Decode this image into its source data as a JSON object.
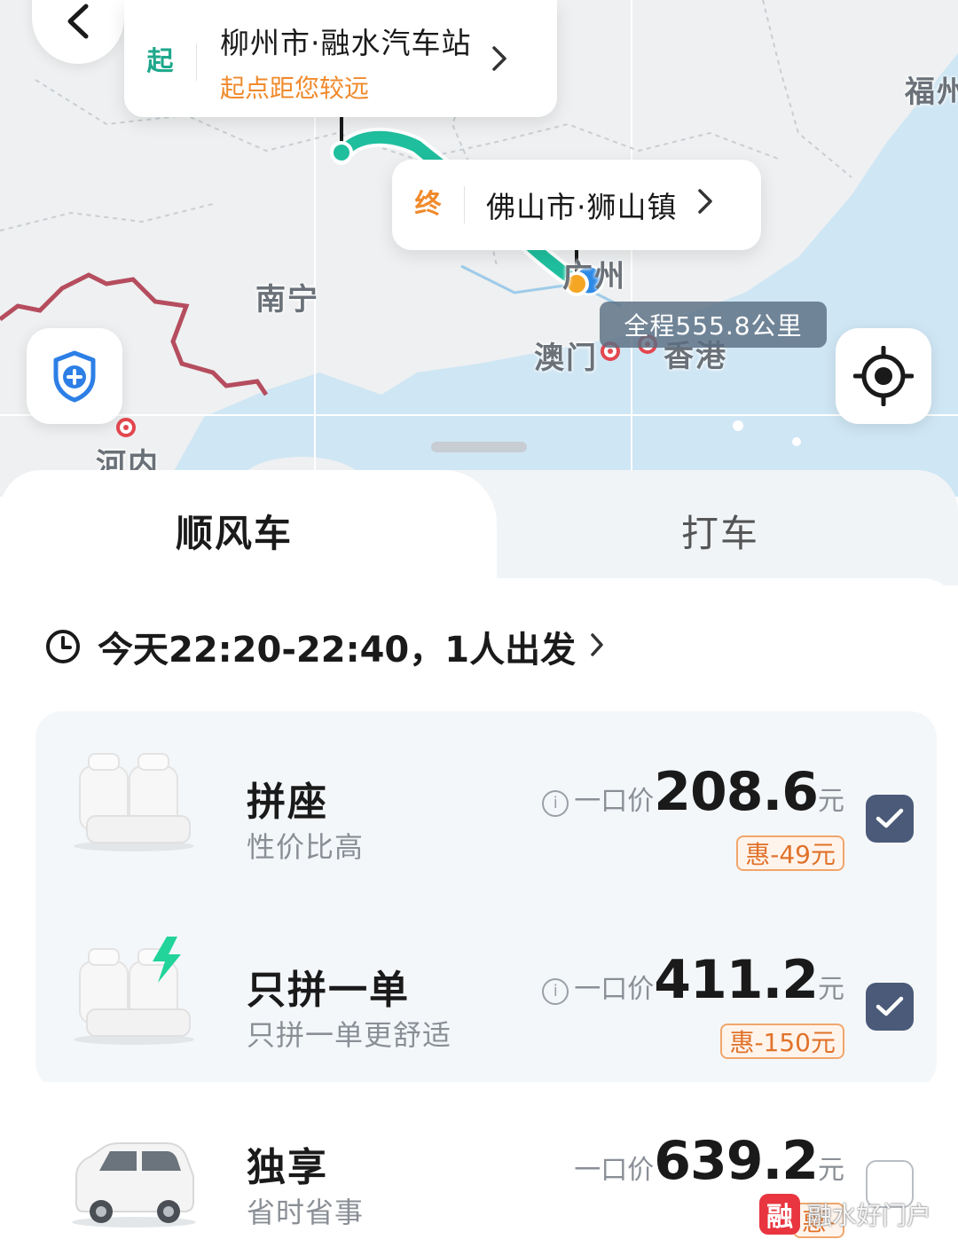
{
  "map": {
    "labels": {
      "nanning": "南宁",
      "hanoi": "河内",
      "macau": "澳门",
      "hongkong": "香港",
      "guangzhou": "广州",
      "fuzhou": "福州"
    },
    "origin": {
      "tag": "起",
      "name": "柳州市·融水汽车站",
      "note": "起点距您较远"
    },
    "destination": {
      "tag": "终",
      "name": "佛山市·狮山镇"
    },
    "distance": "全程555.8公里",
    "colors": {
      "route": "#1fbf9e",
      "sea": "#cfe6f4",
      "border": "#b54d5e",
      "origin_tag": "#1fa88c",
      "destination_tag": "#f08a2c"
    },
    "icons": {
      "back": "chevron-left-icon",
      "safety": "shield-plus-icon",
      "locate": "crosshair-icon"
    }
  },
  "tabs": {
    "active": "顺风车",
    "inactive": "打车"
  },
  "trip": {
    "time_text": "今天22:20-22:40，1人出发",
    "icon": "clock-icon"
  },
  "options": [
    {
      "title": "拼座",
      "subtitle": "性价比高",
      "price_label": "一口价",
      "price": "208.6",
      "unit": "元",
      "discount": "惠-49元",
      "checked": true,
      "icon": "car-seats-icon"
    },
    {
      "title": "只拼一单",
      "subtitle": "只拼一单更舒适",
      "price_label": "一口价",
      "price": "411.2",
      "unit": "元",
      "discount": "惠-150元",
      "checked": true,
      "icon": "car-seats-lightning-icon"
    },
    {
      "title": "独享",
      "subtitle": "省时省事",
      "price_label": "一口价",
      "price": "639.2",
      "unit": "元",
      "discount": "惠-",
      "checked": false,
      "icon": "car-icon"
    }
  ],
  "watermark": {
    "badge": "融",
    "text": "融水好门户"
  }
}
